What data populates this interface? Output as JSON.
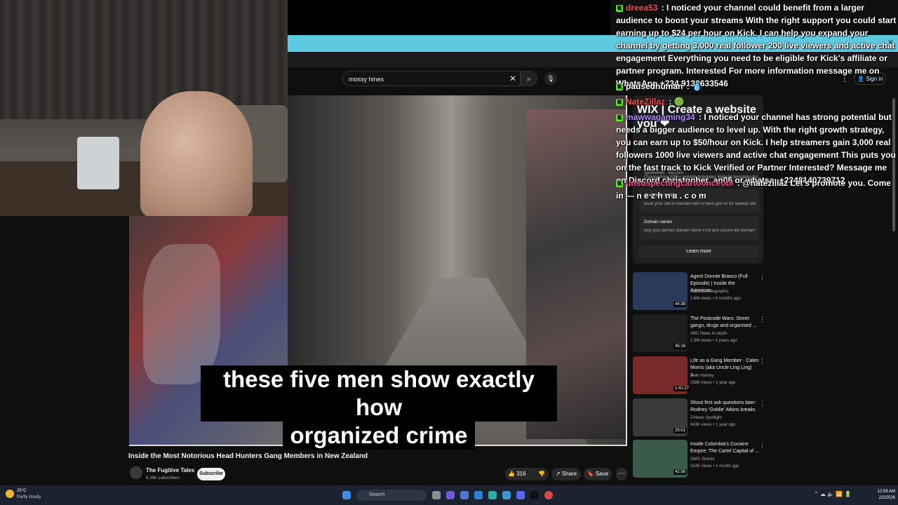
{
  "youtube": {
    "search_value": "mossy hines",
    "search_clear_icon": "✕",
    "search_icon": "⌕",
    "mic_icon": "🎙",
    "more_icon": "⋮",
    "sign_in": "Sign in"
  },
  "video": {
    "caption_line1": "these five men show exactly how",
    "caption_line2": "organized crime",
    "title": "Inside the Most Notorious Head Hunters Gang Members in New Zealand",
    "channel": "The Fugitive Tales",
    "subscribers": "6.26K subscribers",
    "subscribe_label": "Subscribe",
    "likes": "316",
    "share_label": "Share",
    "save_label": "Save",
    "more": "⋯"
  },
  "ad": {
    "wix_text": "WIX | Create a website you ❤",
    "sponsored": "Sponsored · wix.com",
    "templates_text": "Choose from 2000+ website templates Website templates for...",
    "items": [
      {
        "title": "AI website builder",
        "desc": "Build your site in minutes with AI Next-gen AI for speedy site ..."
      },
      {
        "title": "Domain names",
        "desc": "Buy your perfect domain name Find and secure the domain y..."
      }
    ],
    "learn_more": "Learn more"
  },
  "recommendations": [
    {
      "title": "Agent Donnie Brasco (Full Episode) | Inside the American...",
      "channel": "National Geographic",
      "views": "1.6M views • 8 months ago",
      "duration": "44:38",
      "thumb_color": "#2a3a5a"
    },
    {
      "title": "The Postcode Wars: Street gangs, drugs and organised ...",
      "channel": "ABC News In-depth",
      "views": "1.9M views • 3 years ago",
      "duration": "45:16",
      "thumb_color": "#1e1e1e"
    },
    {
      "title": "Life as a Gang Member - Calen Morris (aka Uncle Ling Ling) o...",
      "channel": "Dom Harvey",
      "views": "258K views • 1 year ago",
      "duration": "1:41:27",
      "thumb_color": "#7a2a2a"
    },
    {
      "title": "Shoot first ask questions later: Rodney 'Goldie' Atkins breaks ...",
      "channel": "7 News Spotlight",
      "views": "843K views • 1 year ago",
      "duration": "25:01",
      "thumb_color": "#3a3a3a"
    },
    {
      "title": "Inside Colombia's Cocaine Empire: The Cartel Capital of ...",
      "channel": "OMG Stories",
      "views": "314K views • 1 month ago",
      "duration": "42:56",
      "thumb_color": "#3a5a4a"
    }
  ],
  "chat": [
    {
      "user": "dreea53",
      "user_color": "#ff4c4c",
      "text": "I noticed your channel could benefit from a larger audience to boost your streams With the right support you could start earning up to $24 per hour on Kick. I can help you expand your channel by getting 3,000 real follower 200 live viewers and active chat engagement Everything you need to be eligible for Kick's affiliate or partner program. Interested For more information message me on WhatsApp +234 9138633546"
    },
    {
      "user": "pausedhuman",
      "user_color": "#ffffff",
      "text": "💧"
    },
    {
      "user": "NateZillaz",
      "user_color": "#ff4c4c",
      "text": "🟢"
    },
    {
      "user": "mawwagaming34",
      "user_color": "#b48cff",
      "text": "I noticed your channel has strong potential but needs a bigger audience to level up. With the right growth strategy, you can earn up to $50/hour on Kick. I help streamers gain 3,000 real followers 1000 live viewers and active chat engagement This puts you on the fast track to Kick Verified or Partner Interested? Message me on Discord christopher_an06 or whatsa; +2348140739712"
    },
    {
      "user": "unsuspectingcartoonceobi",
      "user_color": "#ff4c9a",
      "text": "@natezillaz Let's promote you. Come in — n e z h n a . c o m"
    }
  ],
  "taskbar": {
    "temp": "25°C",
    "weather": "Partly cloudy",
    "search_placeholder": "Search",
    "time": "12:59 AM",
    "date": "2/2/2026"
  }
}
